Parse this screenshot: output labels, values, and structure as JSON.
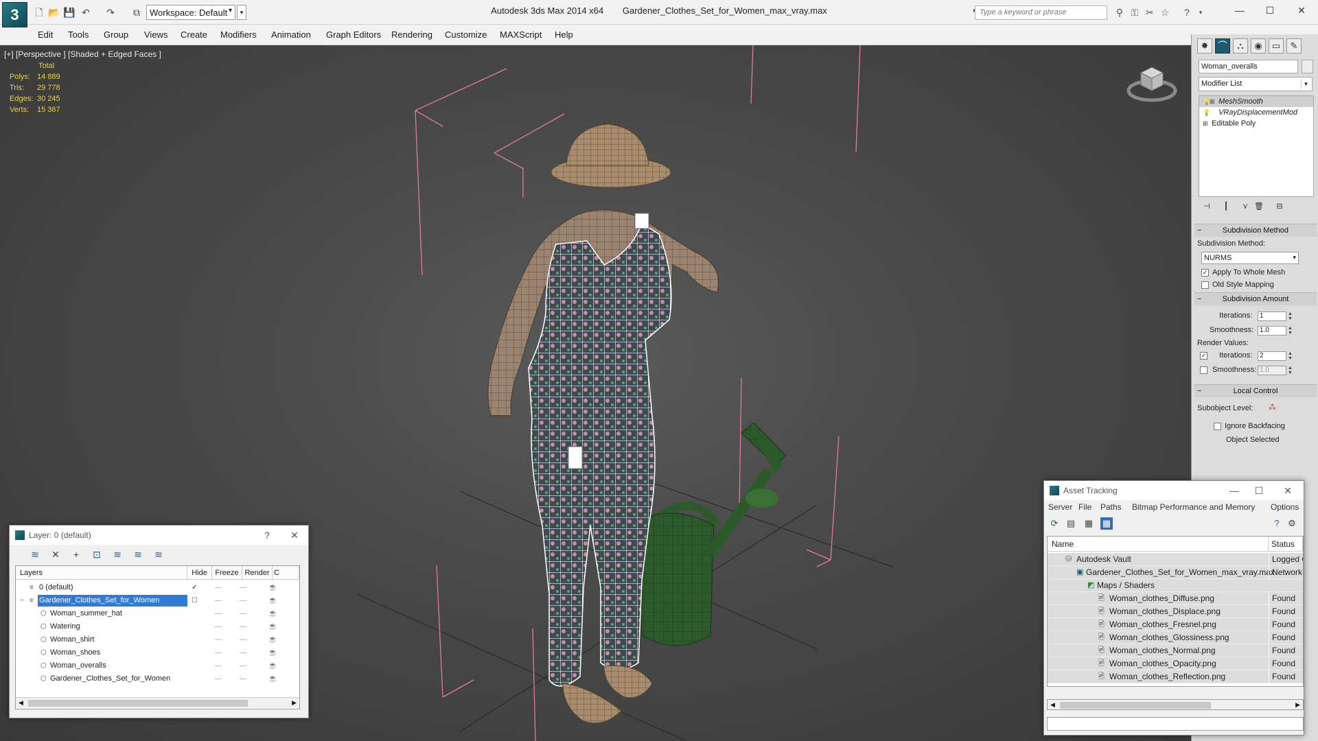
{
  "titlebar": {
    "app_name": "Autodesk 3ds Max  2014 x64",
    "file_name": "Gardener_Clothes_Set_for_Women_max_vray.max",
    "workspace": "Workspace: Default",
    "search_placeholder": "Type a keyword or phrase"
  },
  "menu": [
    "Edit",
    "Tools",
    "Group",
    "Views",
    "Create",
    "Modifiers",
    "Animation",
    "Graph Editors",
    "Rendering",
    "Customize",
    "MAXScript",
    "Help"
  ],
  "viewport": {
    "label": "[+] [Perspective ] [Shaded + Edged Faces ]",
    "stats_header": "Total",
    "stats": [
      {
        "key": "Polys:",
        "value": "14 889"
      },
      {
        "key": "Tris:",
        "value": "29 778"
      },
      {
        "key": "Edges:",
        "value": "30 245"
      },
      {
        "key": "Verts:",
        "value": "15 367"
      }
    ]
  },
  "command_panel": {
    "object_name": "Woman_overalls",
    "modifier_list": "Modifier List",
    "stack": [
      {
        "label": "MeshSmooth",
        "italic": true
      },
      {
        "label": "VRayDisplacementMod",
        "italic": true
      },
      {
        "label": "Editable Poly",
        "italic": false
      }
    ],
    "subdivision_method": {
      "title": "Subdivision Method",
      "label": "Subdivision Method:",
      "value": "NURMS",
      "apply_whole_mesh": "Apply To Whole Mesh",
      "old_style_mapping": "Old Style Mapping"
    },
    "subdivision_amount": {
      "title": "Subdivision Amount",
      "iterations_label": "Iterations:",
      "iterations": "1",
      "smoothness_label": "Smoothness:",
      "smoothness": "1.0",
      "render_values": "Render Values:",
      "render_iterations_label": "Iterations:",
      "render_iterations": "2",
      "render_smoothness_label": "Smoothness:",
      "render_smoothness": "1.0"
    },
    "local_control": {
      "title": "Local Control",
      "subobject_level": "Subobject Level:",
      "ignore_backfacing": "Ignore Backfacing",
      "object_selected": "Object Selected"
    }
  },
  "layer_manager": {
    "title": "Layer: 0 (default)",
    "help": "?",
    "columns": [
      "Layers",
      "Hide",
      "Freeze",
      "Render",
      "C"
    ],
    "rows": [
      {
        "name": "0 (default)",
        "level": 1
      },
      {
        "name": "Gardener_Clothes_Set_for_Women",
        "level": 1,
        "selected": true
      },
      {
        "name": "Woman_summer_hat",
        "level": 2
      },
      {
        "name": "Watering",
        "level": 2
      },
      {
        "name": "Woman_shirt",
        "level": 2
      },
      {
        "name": "Woman_shoes",
        "level": 2
      },
      {
        "name": "Woman_overalls",
        "level": 2
      },
      {
        "name": "Gardener_Clothes_Set_for_Women",
        "level": 2
      }
    ]
  },
  "asset_tracking": {
    "title": "Asset Tracking",
    "menu": [
      "Server",
      "File",
      "Paths",
      "Bitmap Performance and Memory",
      "Options"
    ],
    "columns": [
      "Name",
      "Status"
    ],
    "rows": [
      {
        "name": "Autodesk Vault",
        "status": "Logged Out",
        "level": 0
      },
      {
        "name": "Gardener_Clothes_Set_for_Women_max_vray.max",
        "status": "Network",
        "level": 1
      },
      {
        "name": "Maps / Shaders",
        "status": "",
        "level": 2
      },
      {
        "name": "Woman_clothes_Diffuse.png",
        "status": "Found",
        "level": 3
      },
      {
        "name": "Woman_clothes_Displace.png",
        "status": "Found",
        "level": 3
      },
      {
        "name": "Woman_clothes_Fresnel.png",
        "status": "Found",
        "level": 3
      },
      {
        "name": "Woman_clothes_Glossiness.png",
        "status": "Found",
        "level": 3
      },
      {
        "name": "Woman_clothes_Normal.png",
        "status": "Found",
        "level": 3
      },
      {
        "name": "Woman_clothes_Opacity.png",
        "status": "Found",
        "level": 3
      },
      {
        "name": "Woman_clothes_Reflection.png",
        "status": "Found",
        "level": 3
      }
    ]
  }
}
